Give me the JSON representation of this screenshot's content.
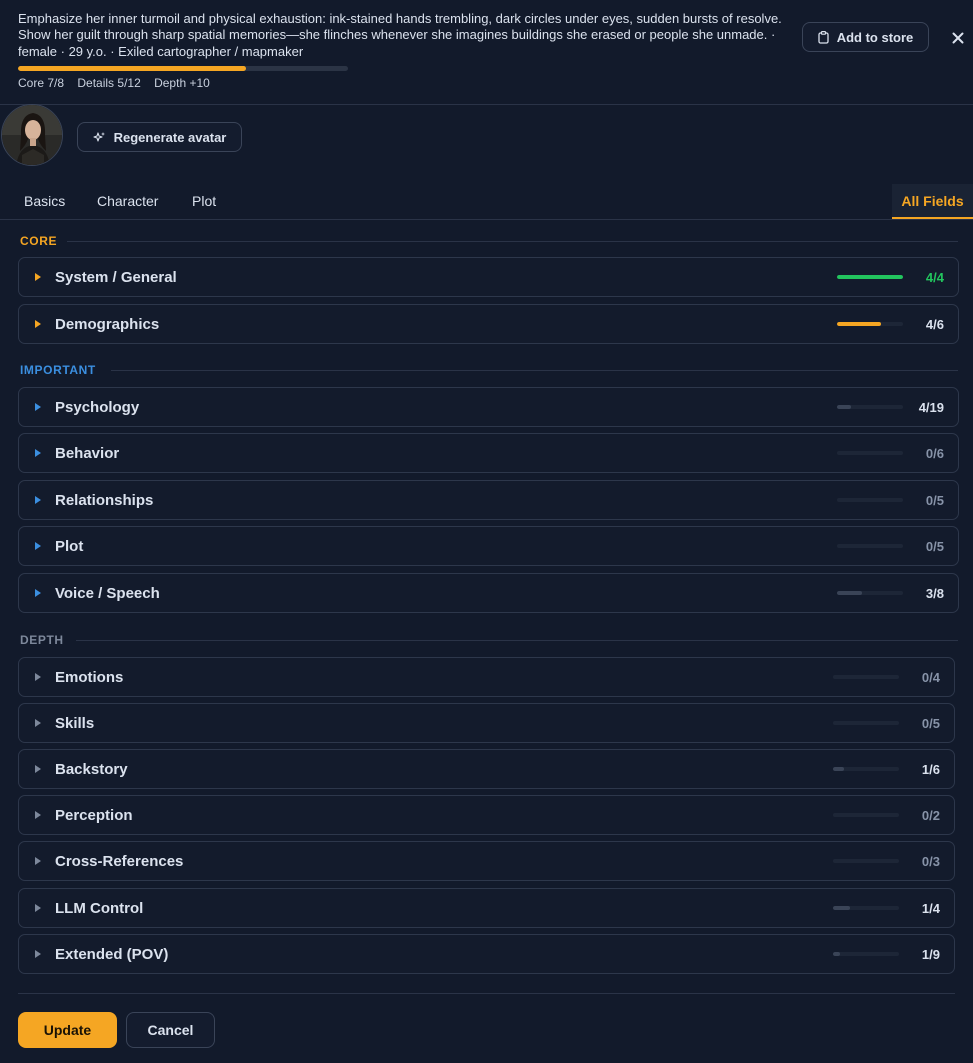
{
  "header": {
    "description": "Emphasize her inner turmoil and physical exhaustion: ink-stained hands trembling, dark circles under eyes, sudden bursts of resolve. Show her guilt through sharp spatial memories—she flinches whenever she imagines buildings she erased or people she unmade. · female · 29 y.o. · Exiled cartographer / mapmaker",
    "progress": 0.69,
    "stats": {
      "core": "Core 7/8",
      "details": "Details 5/12",
      "depth": "Depth +10"
    },
    "add_to_store_label": "Add to store"
  },
  "avatar": {
    "regenerate_label": "Regenerate avatar"
  },
  "tabs": [
    "Basics",
    "Character",
    "Plot",
    "All Fields"
  ],
  "active_tab": "All Fields",
  "sections": {
    "core": {
      "label": "CORE",
      "color": "#f5a623",
      "rows": [
        {
          "label": "System / General",
          "count": "4/4",
          "fill": 1.0,
          "fill_color": "#22c55e",
          "count_color": "#22c55e"
        },
        {
          "label": "Demographics",
          "count": "4/6",
          "fill": 0.67,
          "fill_color": "#f5a623",
          "count_color": "#dbe2ee"
        }
      ]
    },
    "important": {
      "label": "IMPORTANT",
      "color": "#3b8fe0",
      "rows": [
        {
          "label": "Psychology",
          "count": "4/19",
          "fill": 0.21,
          "fill_color": "#3a4457",
          "count_color": "#dbe2ee"
        },
        {
          "label": "Behavior",
          "count": "0/6",
          "fill": 0,
          "fill_color": "#3a4457",
          "count_color": "#8793a8"
        },
        {
          "label": "Relationships",
          "count": "0/5",
          "fill": 0,
          "fill_color": "#3a4457",
          "count_color": "#8793a8"
        },
        {
          "label": "Plot",
          "count": "0/5",
          "fill": 0,
          "fill_color": "#3a4457",
          "count_color": "#8793a8"
        },
        {
          "label": "Voice / Speech",
          "count": "3/8",
          "fill": 0.375,
          "fill_color": "#3a4457",
          "count_color": "#dbe2ee"
        }
      ]
    },
    "depth": {
      "label": "DEPTH",
      "color": "#7d889b",
      "rows": [
        {
          "label": "Emotions",
          "count": "0/4",
          "fill": 0,
          "fill_color": "#3a4457",
          "count_color": "#8793a8"
        },
        {
          "label": "Skills",
          "count": "0/5",
          "fill": 0,
          "fill_color": "#3a4457",
          "count_color": "#8793a8"
        },
        {
          "label": "Backstory",
          "count": "1/6",
          "fill": 0.17,
          "fill_color": "#3a4457",
          "count_color": "#dbe2ee"
        },
        {
          "label": "Perception",
          "count": "0/2",
          "fill": 0,
          "fill_color": "#3a4457",
          "count_color": "#8793a8"
        },
        {
          "label": "Cross-References",
          "count": "0/3",
          "fill": 0,
          "fill_color": "#3a4457",
          "count_color": "#8793a8"
        },
        {
          "label": "LLM Control",
          "count": "1/4",
          "fill": 0.25,
          "fill_color": "#3a4457",
          "count_color": "#dbe2ee"
        },
        {
          "label": "Extended (POV)",
          "count": "1/9",
          "fill": 0.11,
          "fill_color": "#3a4457",
          "count_color": "#dbe2ee"
        }
      ]
    }
  },
  "footer": {
    "update_label": "Update",
    "cancel_label": "Cancel"
  },
  "colors": {
    "accent": "#f5a623",
    "background": "#121a2b",
    "success": "#22c55e",
    "info": "#3b8fe0"
  }
}
